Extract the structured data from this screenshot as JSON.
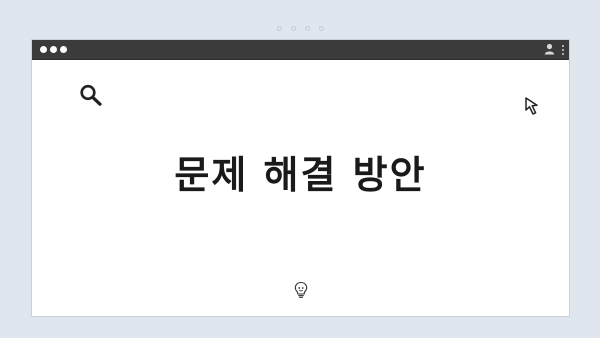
{
  "pager": {
    "dots": 4
  },
  "window": {
    "titlebar": {
      "traffic_dots": 3
    },
    "icons": {
      "search": "search-icon",
      "cursor": "cursor-arrow-icon",
      "profile": "user-icon",
      "menu": "kebab-menu-icon",
      "bulb": "lightbulb-icon"
    }
  },
  "content": {
    "title": "문제 해결 방안"
  },
  "colors": {
    "background": "#dfe6ee",
    "titlebar": "#3b3b3b",
    "text": "#1a1a1a"
  }
}
